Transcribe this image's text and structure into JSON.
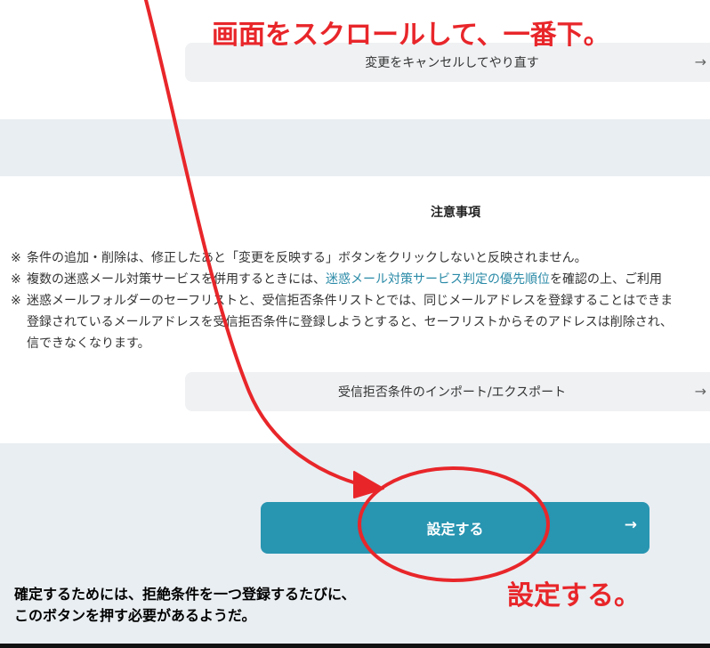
{
  "buttons": {
    "redo_label": "変更をキャンセルしてやり直す",
    "import_export_label": "受信拒否条件のインポート/エクスポート",
    "submit_label": "設定する",
    "arrow": "→"
  },
  "notes": {
    "title": "注意事項",
    "mark": "※",
    "item1": "条件の追加・削除は、修正したあと「変更を反映する」ボタンをクリックしないと反映されません。",
    "item2_before": "複数の迷惑メール対策サービスを併用するときには、",
    "item2_link": "迷惑メール対策サービス判定の優先順位",
    "item2_after": "を確認の上、ご利用",
    "item3_line1": "迷惑メールフォルダーのセーフリストと、受信拒否条件リストとでは、同じメールアドレスを登録することはできま",
    "item3_line2": "登録されているメールアドレスを受信拒否条件に登録しようとすると、セーフリストからそのアドレスは削除され、",
    "item3_line3": "信できなくなります。"
  },
  "annotations": {
    "scroll_text": "画面をスクロールして、一番下。",
    "set_text": "設定する。",
    "comment_line1": "確定するためには、拒絶条件を一つ登録するたびに、",
    "comment_line2": "このボタンを押す必要があるようだ。",
    "color": "#e8262a"
  },
  "colors": {
    "accent": "#2895b1",
    "link": "#2a8aa7"
  }
}
